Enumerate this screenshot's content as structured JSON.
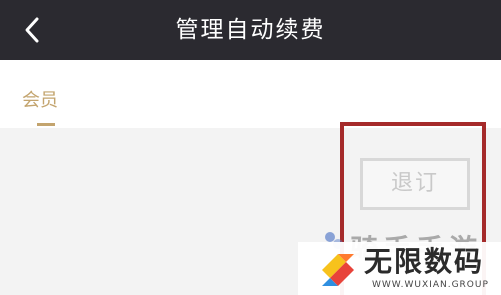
{
  "header": {
    "title": "管理自动续费",
    "back_icon": "chevron-left-icon"
  },
  "tabs": [
    {
      "label": "会员",
      "active": true
    }
  ],
  "actions": {
    "unsubscribe_label": "退订"
  },
  "watermark": {
    "faded_text": "骑手手游",
    "brand_text": "无限数码",
    "brand_sub": "WWW.WUXIAN.GROUP"
  },
  "colors": {
    "topbar_bg": "#2b2a30",
    "accent_gold": "#c3a46e",
    "highlight_red": "#a52a2a"
  }
}
